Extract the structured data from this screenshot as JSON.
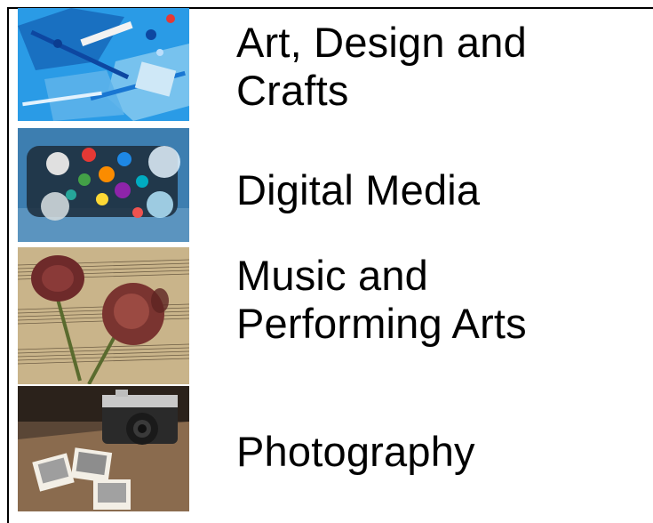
{
  "categories": [
    {
      "lines": [
        "Art, Design and",
        "Crafts"
      ],
      "image_icon": "art-supplies-photo"
    },
    {
      "lines": [
        "Digital Media"
      ],
      "image_icon": "social-media-apps-photo"
    },
    {
      "lines": [
        "Music and",
        "Performing Arts"
      ],
      "image_icon": "dried-roses-on-sheet-music-photo"
    },
    {
      "lines": [
        "Photography"
      ],
      "image_icon": "vintage-camera-and-polaroids-photo"
    }
  ]
}
